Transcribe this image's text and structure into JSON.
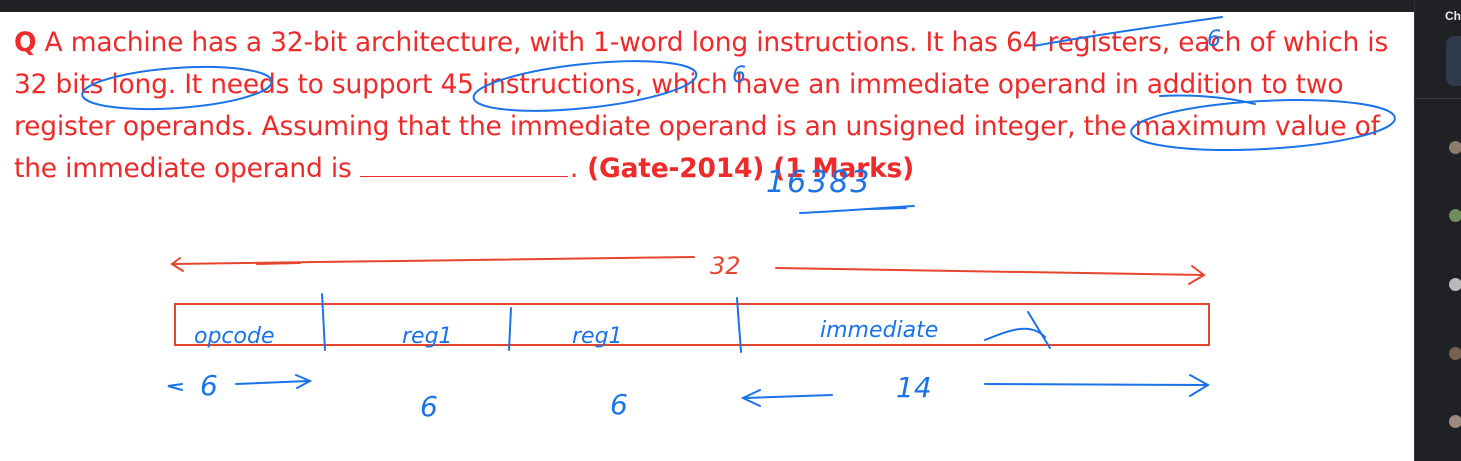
{
  "question": {
    "prefix": "Q",
    "body": " A machine has a 32-bit architecture, with 1-word long instructions. It has 64 registers, each of which is 32 bits long. It needs to support 45 instructions, which have an immediate operand in addition to two register operands. Assuming that the immediate operand is an unsigned integer, the maximum value of the immediate operand is ",
    "suffix": ".",
    "reference": " (Gate-2014) (1 Marks)"
  },
  "annotations": {
    "answer": "16383",
    "registers_bits": "6",
    "instructions_bits": "6",
    "word_size": "32",
    "field_labels": [
      "opcode",
      "reg1",
      "reg1",
      "immediate"
    ],
    "field_bits": [
      "6",
      "6",
      "6",
      "14"
    ]
  },
  "sidebar": {
    "title": "Ch"
  },
  "colors": {
    "question_text": "#ee2a2a",
    "pen_blue": "#1a73e8",
    "pen_red": "#e5462f",
    "background": "#ffffff"
  }
}
